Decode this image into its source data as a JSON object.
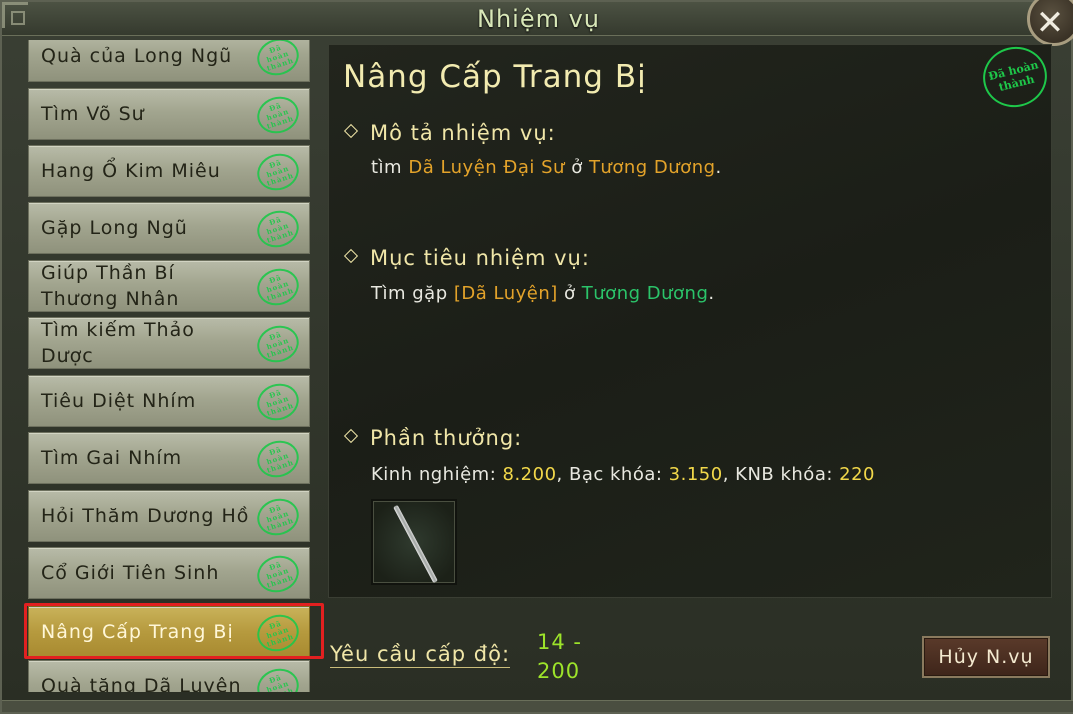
{
  "window": {
    "title": "Nhiệm vụ"
  },
  "quests": [
    {
      "label": "Quà của Long Ngũ",
      "stamp": "Đã hoàn thành"
    },
    {
      "label": "Tìm Võ Sư",
      "stamp": "Đã hoàn thành"
    },
    {
      "label": "Hang Ổ Kim Miêu",
      "stamp": "Đã hoàn thành"
    },
    {
      "label": "Gặp Long Ngũ",
      "stamp": "Đã hoàn thành"
    },
    {
      "label": "Giúp Thần Bí Thương Nhân",
      "stamp": "Đã hoàn thành"
    },
    {
      "label": "Tìm kiếm Thảo Dược",
      "stamp": "Đã hoàn thành"
    },
    {
      "label": "Tiêu Diệt Nhím",
      "stamp": "Đã hoàn thành"
    },
    {
      "label": "Tìm Gai Nhím",
      "stamp": "Đã hoàn thành"
    },
    {
      "label": "Hỏi Thăm Dương Hồ",
      "stamp": "Đã hoàn thành"
    },
    {
      "label": "Cổ Giới Tiên Sinh",
      "stamp": "Đã hoàn thành"
    },
    {
      "label": "Nâng Cấp Trang Bị",
      "stamp": "Đã hoàn thành",
      "selected": true
    },
    {
      "label": "Quà tặng Dã Luyện",
      "stamp": "Đã hoàn thành"
    }
  ],
  "detail": {
    "title": "Nâng Cấp Trang Bị",
    "stamp": "Đã hoàn thành",
    "description": {
      "heading": "Mô tả nhiệm vụ:",
      "prefix": "tìm",
      "npc": "Dã Luyện Đại Sư",
      "middle": "ở",
      "place": "Tương Dương",
      "suffix": "."
    },
    "objective": {
      "heading": "Mục tiêu nhiệm vụ:",
      "prefix": "Tìm gặp",
      "npc": "[Dã Luyện]",
      "middle": "ở",
      "place": "Tương Dương",
      "suffix": "."
    },
    "reward": {
      "heading": "Phần thưởng:",
      "exp_label": "Kinh nghiệm:",
      "exp_value": "8.200",
      "silver_label": "Bạc khóa:",
      "silver_value": "3.150",
      "knb_label": "KNB khóa:",
      "knb_value": "220",
      "item_icon": "sword-icon"
    }
  },
  "footer": {
    "level_label": "Yêu cầu cấp độ:",
    "level_min": "14 -",
    "level_max": "200",
    "cancel_label": "Hủy N.vụ"
  }
}
